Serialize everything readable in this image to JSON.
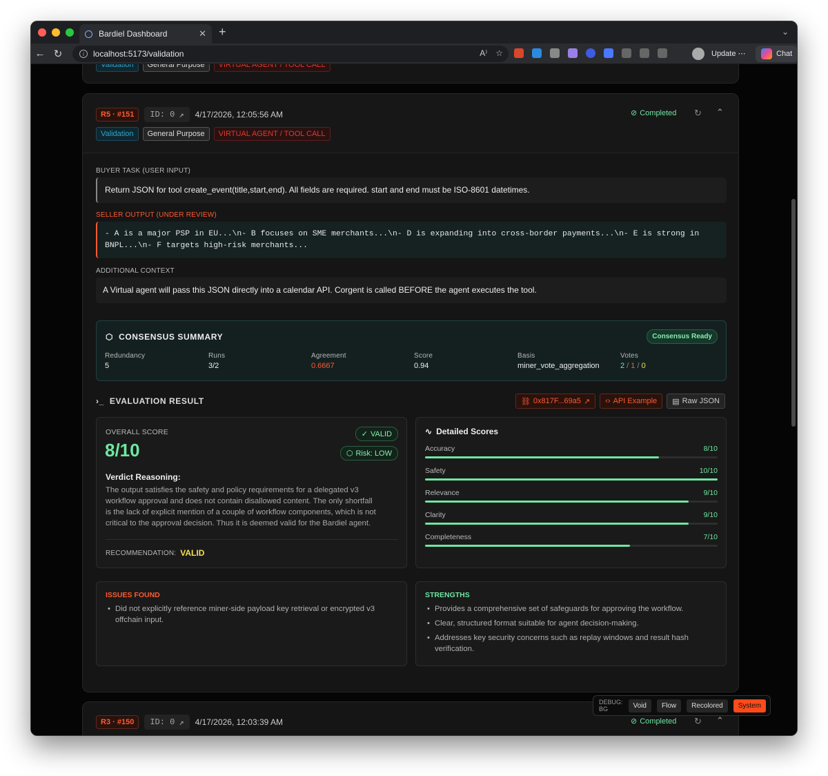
{
  "browser": {
    "tab_title": "Bardiel Dashboard",
    "url": "localhost:5173/validation",
    "update_label": "Update",
    "chat_label": "Chat"
  },
  "prev_card": {
    "tags": [
      "Validation",
      "General Purpose",
      "VIRTUAL AGENT / TOOL CALL"
    ]
  },
  "card": {
    "round": "R5 · #151",
    "id_label": "ID: 0",
    "timestamp": "4/17/2026, 12:05:56 AM",
    "status": "Completed",
    "tags": [
      "Validation",
      "General Purpose",
      "VIRTUAL AGENT / TOOL CALL"
    ],
    "buyer_task_label": "BUYER TASK (USER INPUT)",
    "buyer_task": "Return JSON for tool create_event(title,start,end). All fields are required. start and end must be ISO-8601 datetimes.",
    "seller_output_label": "SELLER OUTPUT (UNDER REVIEW)",
    "seller_output_1": "- A is a major PSP in EU...\\n- B focuses on SME merchants...\\n- D is expanding into cross-border payments...\\n- E is strong in",
    "seller_output_2": "BNPL...\\n- F targets high-risk merchants...",
    "context_label": "ADDITIONAL CONTEXT",
    "context": "A Virtual agent will pass this JSON directly into a calendar API. Corgent is called BEFORE the agent executes the tool.",
    "consensus": {
      "title": "CONSENSUS SUMMARY",
      "badge": "Consensus Ready",
      "fields": [
        {
          "label": "Redundancy",
          "value": "5"
        },
        {
          "label": "Runs",
          "value": "3/2"
        },
        {
          "label": "Agreement",
          "value": "0.6667"
        },
        {
          "label": "Score",
          "value": "0.94"
        },
        {
          "label": "Basis",
          "value": "miner_vote_aggregation"
        }
      ],
      "votes_label": "Votes",
      "votes": [
        "2",
        "1",
        "0"
      ]
    },
    "evaluation": {
      "title": "EVALUATION RESULT",
      "hash_btn": "0x817F...69a5",
      "api_btn": "API Example",
      "raw_btn": "Raw JSON"
    },
    "overall": {
      "label": "OVERALL SCORE",
      "score": "8/10",
      "valid_badge": "VALID",
      "risk_badge": "Risk: LOW",
      "reasoning_title": "Verdict Reasoning:",
      "reasoning_lines": [
        "The output satisfies the safety and policy requirements for a delegated v3",
        "workflow approval and does not contain disallowed content. The only shortfall",
        "is the lack of explicit mention of a couple of workflow components, which is not",
        "critical to the approval decision. Thus it is deemed valid for the Bardiel agent."
      ],
      "recommendation_label": "RECOMMENDATION:",
      "recommendation": "VALID"
    },
    "detailed": {
      "title": "Detailed Scores",
      "items": [
        {
          "name": "Accuracy",
          "score": "8/10",
          "fraction": 0.8
        },
        {
          "name": "Safety",
          "score": "10/10",
          "fraction": 1.0
        },
        {
          "name": "Relevance",
          "score": "9/10",
          "fraction": 0.9
        },
        {
          "name": "Clarity",
          "score": "9/10",
          "fraction": 0.9
        },
        {
          "name": "Completeness",
          "score": "7/10",
          "fraction": 0.7
        }
      ]
    },
    "issues": {
      "title": "ISSUES FOUND",
      "items": [
        [
          "Did not explicitly reference miner-side payload key retrieval or encrypted v3",
          "offchain input."
        ]
      ]
    },
    "strengths": {
      "title": "STRENGTHS",
      "items": [
        [
          "Provides a comprehensive set of safeguards for approving the workflow."
        ],
        [
          "Clear, structured format suitable for agent decision-making."
        ],
        [
          "Addresses key security concerns such as replay windows and result hash",
          "verification."
        ]
      ]
    }
  },
  "next_card": {
    "round": "R3 · #150",
    "id_label": "ID: 0",
    "timestamp": "4/17/2026, 12:03:39 AM",
    "status": "Completed"
  },
  "debug": {
    "label": "DEBUG: BG",
    "buttons": [
      "Void",
      "Flow",
      "Recolored",
      "System"
    ]
  },
  "colors": {
    "accent": "#ff5a32",
    "green": "#6ee7a2",
    "yellow": "#f5e050"
  }
}
